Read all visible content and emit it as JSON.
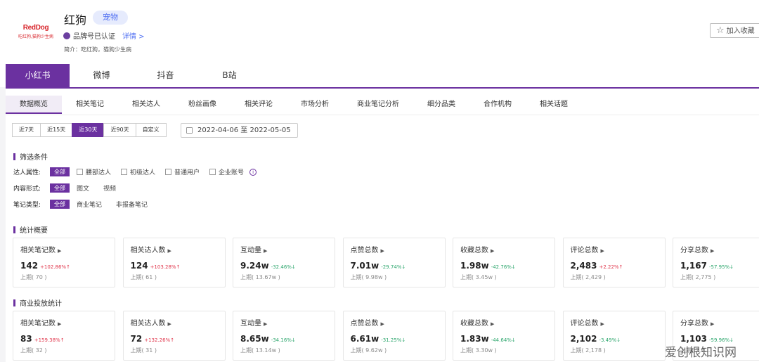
{
  "brand": {
    "logo_text": "RedDog",
    "logo_sub": "吃红狗,猫狗少生病",
    "name": "红狗",
    "tag": "宠物",
    "cert_label": "品牌号已认证",
    "detail_link": "详情 >",
    "intro": "简介：吃红狗，猫狗少生病",
    "favorite_label": "加入收藏"
  },
  "platforms": [
    "小红书",
    "微博",
    "抖音",
    "B站"
  ],
  "subtabs": [
    "数据概览",
    "相关笔记",
    "相关达人",
    "粉丝画像",
    "相关评论",
    "市场分析",
    "商业笔记分析",
    "细分品类",
    "合作机构",
    "相关话题"
  ],
  "date_ranges": [
    "近7天",
    "近15天",
    "近30天",
    "近90天",
    "自定义"
  ],
  "date_range_value": "2022-04-06 至 2022-05-05",
  "filters": {
    "title": "筛选条件",
    "influencer_label": "达人属性:",
    "influencer_all": "全部",
    "influencer_options": [
      "腰部达人",
      "初级达人",
      "普通用户",
      "企业账号"
    ],
    "content_label": "内容形式:",
    "content_all": "全部",
    "content_options": [
      "图文",
      "视频"
    ],
    "note_label": "笔记类型:",
    "note_all": "全部",
    "note_options": [
      "商业笔记",
      "非报备笔记"
    ]
  },
  "stats_title": "统计概要",
  "stats": [
    {
      "title": "相关笔记数",
      "value": "142",
      "change": "+102.86%↑",
      "dir": "up",
      "prev": "上期( 70 )"
    },
    {
      "title": "相关达人数",
      "value": "124",
      "change": "+103.28%↑",
      "dir": "up",
      "prev": "上期( 61 )"
    },
    {
      "title": "互动量",
      "value": "9.24w",
      "change": "-32.46%↓",
      "dir": "down",
      "prev": "上期( 13.67w )"
    },
    {
      "title": "点赞总数",
      "value": "7.01w",
      "change": "-29.74%↓",
      "dir": "down",
      "prev": "上期( 9.98w )"
    },
    {
      "title": "收藏总数",
      "value": "1.98w",
      "change": "-42.76%↓",
      "dir": "down",
      "prev": "上期( 3.45w )"
    },
    {
      "title": "评论总数",
      "value": "2,483",
      "change": "+2.22%↑",
      "dir": "up",
      "prev": "上期( 2,429 )"
    },
    {
      "title": "分享总数",
      "value": "1,167",
      "change": "-57.95%↓",
      "dir": "down",
      "prev": "上期( 2,775 )"
    }
  ],
  "biz_title": "商业投放统计",
  "biz": [
    {
      "title": "相关笔记数",
      "value": "83",
      "change": "+159.38%↑",
      "dir": "up",
      "prev": "上期( 32 )"
    },
    {
      "title": "相关达人数",
      "value": "72",
      "change": "+132.26%↑",
      "dir": "up",
      "prev": "上期( 31 )"
    },
    {
      "title": "互动量",
      "value": "8.65w",
      "change": "-34.16%↓",
      "dir": "down",
      "prev": "上期( 13.14w )"
    },
    {
      "title": "点赞总数",
      "value": "6.61w",
      "change": "-31.25%↓",
      "dir": "down",
      "prev": "上期( 9.62w )"
    },
    {
      "title": "收藏总数",
      "value": "1.83w",
      "change": "-44.64%↓",
      "dir": "down",
      "prev": "上期( 3.30w )"
    },
    {
      "title": "评论总数",
      "value": "2,102",
      "change": "-3.49%↓",
      "dir": "down",
      "prev": "上期( 2,178 )"
    },
    {
      "title": "分享总数",
      "value": "1,103",
      "change": "-59.96%↓",
      "dir": "down",
      "prev": "上期( 2,7…"
    }
  ],
  "watermark": "爱创根知识网",
  "colors": {
    "accent": "#6b31a0",
    "up": "#e0344a",
    "down": "#2aa56b",
    "link": "#4e6ef2"
  }
}
